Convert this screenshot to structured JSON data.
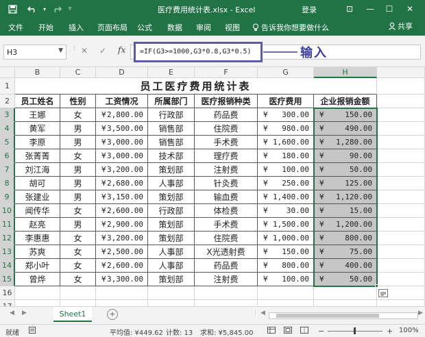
{
  "window": {
    "title": "医疗费用统计表.xlsx  -  Excel",
    "login": "登录",
    "minimize": "—",
    "restore": "☐",
    "close": "✕",
    "ribbon_display": "⊡"
  },
  "ribbon": {
    "tabs": [
      "文件",
      "开始",
      "插入",
      "页面布局",
      "公式",
      "数据",
      "审阅",
      "视图"
    ],
    "tell_me": "告诉我你想要做什么",
    "share": "共享"
  },
  "formula_bar": {
    "name_box": "H3",
    "cancel": "✕",
    "enter": "✓",
    "fx": "fx",
    "formula": "=IF(G3>=1000,G3*0.8,G3*0.5)",
    "annotation": "输入"
  },
  "grid": {
    "columns": [
      "B",
      "C",
      "D",
      "E",
      "F",
      "G",
      "H"
    ],
    "selected_column": "H",
    "rows": [
      "1",
      "2",
      "3",
      "4",
      "5",
      "6",
      "7",
      "8",
      "9",
      "10",
      "11",
      "12",
      "13",
      "14",
      "15",
      "16",
      "17"
    ],
    "title": "员工医疗费用统计表",
    "headers": [
      "员工姓名",
      "性别",
      "工资情况",
      "所属部门",
      "医疗报销种类",
      "医疗费用",
      "企业报销金额"
    ],
    "currency_symbol": "¥",
    "data": [
      [
        "王娜",
        "女",
        "2,800.00",
        "行政部",
        "药品费",
        "300.00",
        "150.00"
      ],
      [
        "黄军",
        "男",
        "3,500.00",
        "销售部",
        "住院费",
        "980.00",
        "490.00"
      ],
      [
        "李原",
        "男",
        "3,000.00",
        "销售部",
        "手术费",
        "1,600.00",
        "1,280.00"
      ],
      [
        "张菁菁",
        "女",
        "3,000.00",
        "技术部",
        "理疗费",
        "180.00",
        "90.00"
      ],
      [
        "刘江海",
        "男",
        "3,200.00",
        "策划部",
        "注射费",
        "100.00",
        "50.00"
      ],
      [
        "胡可",
        "男",
        "2,680.00",
        "人事部",
        "针灸费",
        "250.00",
        "125.00"
      ],
      [
        "张建业",
        "男",
        "3,150.00",
        "策划部",
        "输血费",
        "1,400.00",
        "1,120.00"
      ],
      [
        "闻传华",
        "女",
        "2,600.00",
        "行政部",
        "体检费",
        "30.00",
        "15.00"
      ],
      [
        "赵亮",
        "男",
        "2,900.00",
        "策划部",
        "手术费",
        "1,500.00",
        "1,200.00"
      ],
      [
        "李惠惠",
        "女",
        "3,200.00",
        "策划部",
        "住院费",
        "1,000.00",
        "800.00"
      ],
      [
        "苏爽",
        "女",
        "2,500.00",
        "人事部",
        "X光透射费",
        "150.00",
        "75.00"
      ],
      [
        "郑小叶",
        "女",
        "2,600.00",
        "人事部",
        "药品费",
        "800.00",
        "400.00"
      ],
      [
        "曾烨",
        "女",
        "3,300.00",
        "策划部",
        "注射费",
        "100.00",
        "50.00"
      ]
    ]
  },
  "sheets": {
    "active": "Sheet1",
    "add": "+"
  },
  "status": {
    "ready": "就绪",
    "average": "平均值: ¥449.62",
    "count": "计数: 13",
    "sum": "求和: ¥5,845.00",
    "zoom_minus": "−",
    "zoom_plus": "+",
    "zoom": "100%"
  },
  "colors": {
    "accent": "#217346",
    "annotation": "#3d3d9e",
    "selection_fill": "#c6c6c6"
  }
}
